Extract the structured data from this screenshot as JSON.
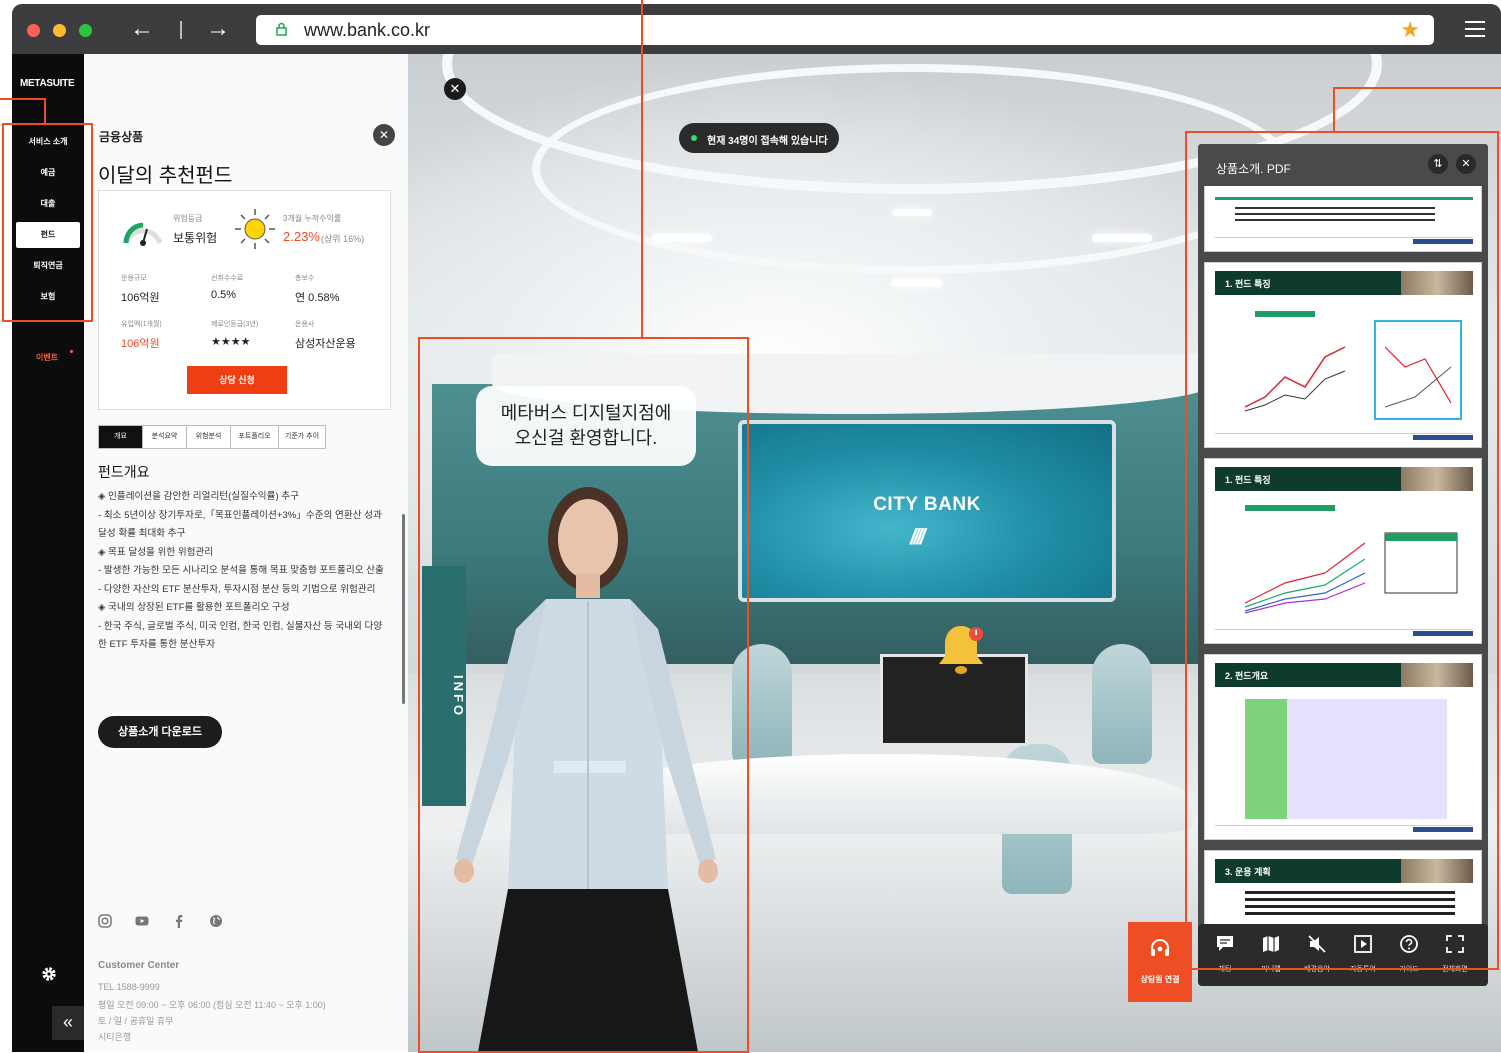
{
  "browser": {
    "url": "www.bank.co.kr",
    "traffic_lights": [
      "#ff5f57",
      "#febc2e",
      "#28c840"
    ]
  },
  "sidenav": {
    "logo": "METASUITE",
    "items": [
      {
        "label": "서비스 소개",
        "active": false
      },
      {
        "label": "예금",
        "active": false
      },
      {
        "label": "대출",
        "active": false
      },
      {
        "label": "펀드",
        "active": true
      },
      {
        "label": "퇴직연금",
        "active": false
      },
      {
        "label": "보험",
        "active": false
      }
    ],
    "event_label": "이벤트",
    "collapse_label": "«"
  },
  "panel": {
    "category": "금융상품",
    "title": "이달의 추천펀드",
    "risk": {
      "label": "위험등급",
      "value": "보통위험"
    },
    "return": {
      "label": "3개월 누적수익률",
      "value": "2.23%",
      "sub": "(상위 16%)"
    },
    "stats": [
      {
        "label": "운용규모",
        "value": "106억원"
      },
      {
        "label": "선취수수료",
        "value": "0.5%"
      },
      {
        "label": "총보수",
        "value": "연 0.58%"
      },
      {
        "label": "유입액(1개월)",
        "value": "106억원"
      },
      {
        "label": "제로인등급(3년)",
        "value": "★★★★"
      },
      {
        "label": "운용사",
        "value": "삼성자산운용"
      }
    ],
    "apply_button": "상담 신청",
    "tabs": [
      "개요",
      "분석요약",
      "위험분석",
      "포트폴리오",
      "기준가 추이"
    ],
    "overview_title": "펀드개요",
    "overview_lines": [
      "◈ 인플레이션을 감안한 리얼리턴(실질수익률) 추구",
      "- 최소 5년이상 장기투자로,「목표인플레이션+3%」수준의 연환산 성과 달성 확률 최대화 추구",
      "◈ 목표 달성을 위한 위험관리",
      "- 발생한 가능한 모든 시나리오 분석을 통해 목표 맞춤형 포트폴리오 산출",
      "- 다양한 자산의 ETF 분산투자, 투자시점 분산 등의 기법으로 위험관리",
      "◈ 국내의 상장된 ETF를 활용한 포트폴리오 구성",
      "- 한국 주식, 글로벌 주식, 미국 인컴, 한국 인컴, 실물자산 등 국내외 다양한 ETF 투자를 통한 분산투자"
    ],
    "download_button": "상품소개 다운로드",
    "customer_center": {
      "title": "Customer Center",
      "tel": "TEL 1588-9999",
      "hours": "평일 오전 09:00 ~ 오후 06:00 (점심 오전 11:40 ~ 오후 1:00)",
      "closed": "토 / 일 / 공휴일 휴무",
      "bank": "시티은행"
    }
  },
  "scene": {
    "visitors_text": "현재 34명이 접속해 있습니다",
    "speech": [
      "메타버스 디지털지점에",
      "오신걸 환영합니다."
    ],
    "screen_title": "CITY BANK",
    "screen_logo": "////",
    "info_sign": "INFO"
  },
  "pdf_viewer": {
    "title": "상품소개. PDF",
    "pages": [
      {
        "heading": ""
      },
      {
        "heading": "1. 펀드 특징"
      },
      {
        "heading": "1. 펀드 특징"
      },
      {
        "heading": "2. 펀드개요"
      },
      {
        "heading": "3. 운용 계획"
      }
    ]
  },
  "bottom_bar": {
    "consult_label": "상담원 연결",
    "tools": [
      {
        "label": "채팅",
        "icon": "chat-icon"
      },
      {
        "label": "미니맵",
        "icon": "map-icon"
      },
      {
        "label": "배경음악",
        "icon": "mute-icon"
      },
      {
        "label": "자동투어",
        "icon": "play-icon"
      },
      {
        "label": "가이드",
        "icon": "help-icon"
      },
      {
        "label": "전체화면",
        "icon": "fullscreen-icon"
      }
    ]
  },
  "colors": {
    "accent": "#ef4e24",
    "nav_bg": "#0c0c0c",
    "chrome_bg": "#3d3d3f",
    "pdf_header": "#0e3b2e"
  }
}
